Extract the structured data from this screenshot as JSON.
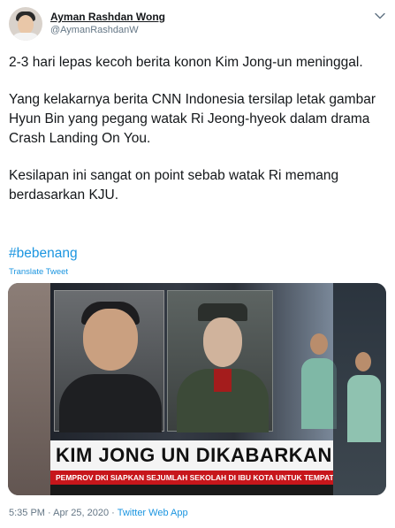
{
  "user": {
    "name": "Ayman Rashdan Wong",
    "handle": "@AymanRashdanW"
  },
  "tweet": {
    "paragraphs": [
      "2-3 hari lepas kecoh berita konon Kim Jong-un meninggal.",
      "Yang kelakarnya berita CNN Indonesia tersilap letak gambar Hyun Bin yang pegang watak Ri Jeong-hyeok dalam drama Crash Landing On You.",
      "Kesilapan ini sangat on point sebab watak Ri memang berdasarkan KJU."
    ],
    "hashtag": "#bebenang",
    "translate_label": "Translate Tweet"
  },
  "media": {
    "headline": "KIM JONG UN DIKABARKAN KRITI",
    "ticker": "PEMPROV DKI SIAPKAN SEJUMLAH SEKOLAH DI IBU KOTA UNTUK TEMPAT ISOLASI PASIEN CO",
    "ticker_color": "#c7161b"
  },
  "meta": {
    "time_date": "5:35 PM · Apr 25, 2020 · ",
    "app": "Twitter Web App"
  },
  "colors": {
    "link": "#1b95e0",
    "secondary": "#657786"
  },
  "icons": {
    "more": "chevron-down-icon"
  }
}
